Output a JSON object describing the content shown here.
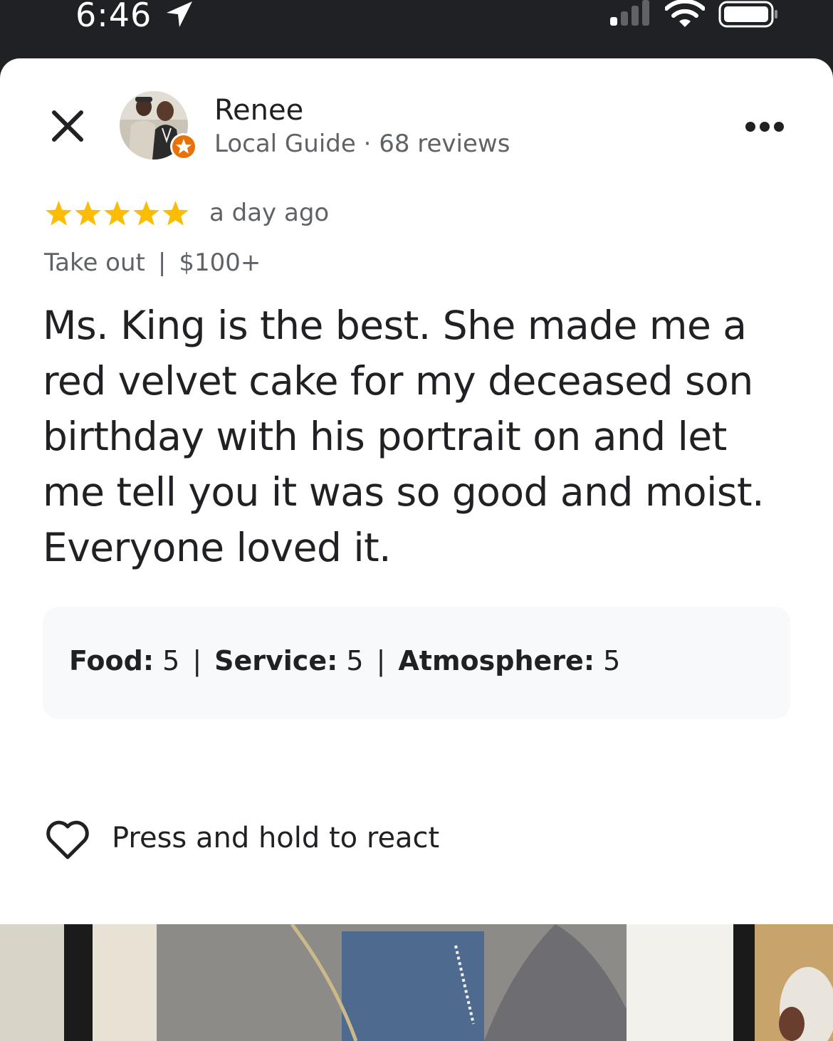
{
  "status_bar": {
    "time": "6:46",
    "icons": [
      "location-arrow-icon",
      "cellular-signal-icon",
      "wifi-icon",
      "battery-icon"
    ]
  },
  "header": {
    "close_icon": "close-icon",
    "reviewer_name": "Renee",
    "reviewer_meta": "Local Guide · 68 reviews",
    "badge_icon": "local-guide-star-icon",
    "more_icon": "more-options-icon"
  },
  "review": {
    "rating": 5,
    "max_rating": 5,
    "date": "a day ago",
    "service_type": "Take out",
    "separator": "|",
    "price": "$100+",
    "text": "Ms. King is the best.  She made me a red velvet cake for my deceased son birthday with his portrait on and let me tell you it was so good and moist. Everyone loved it."
  },
  "ratings": [
    {
      "label": "Food:",
      "value": "5"
    },
    {
      "label": "Service:",
      "value": "5"
    },
    {
      "label": "Atmosphere:",
      "value": "5"
    }
  ],
  "react": {
    "icon": "heart-outline-icon",
    "label": "Press and hold to react"
  },
  "colors": {
    "status_bar_bg": "#202124",
    "star": "#fbbc04",
    "badge": "#e8710a",
    "secondary_text": "#5f6368",
    "ratings_bg": "#f8f9fa"
  }
}
